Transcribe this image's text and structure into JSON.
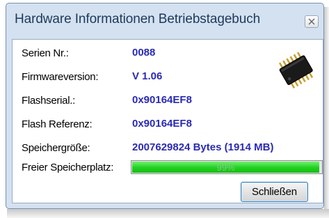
{
  "window": {
    "title": "Hardware Informationen Betriebstagebuch",
    "close_icon": "close-icon"
  },
  "fields": [
    {
      "label": "Serien Nr.:",
      "value": "0088"
    },
    {
      "label": "Firmwareversion:",
      "value": "V 1.06"
    },
    {
      "label": "Flashserial.:",
      "value": "0x90164EF8"
    },
    {
      "label": "Flash Referenz:",
      "value": "0x90164EF8"
    },
    {
      "label": "Speichergröße:",
      "value": "2007629824 Bytes (1914 MB)"
    }
  ],
  "free_space": {
    "label": "Freier Speicherplatz:",
    "percent": 99,
    "percent_text": "99%",
    "fill_color": "#20d020"
  },
  "icon": "memory-chip-icon",
  "buttons": {
    "close_label": "Schließen"
  },
  "colors": {
    "value_text": "#2a2ab5",
    "window_frame": "#d4e1f1",
    "title_text": "#1e395b"
  }
}
